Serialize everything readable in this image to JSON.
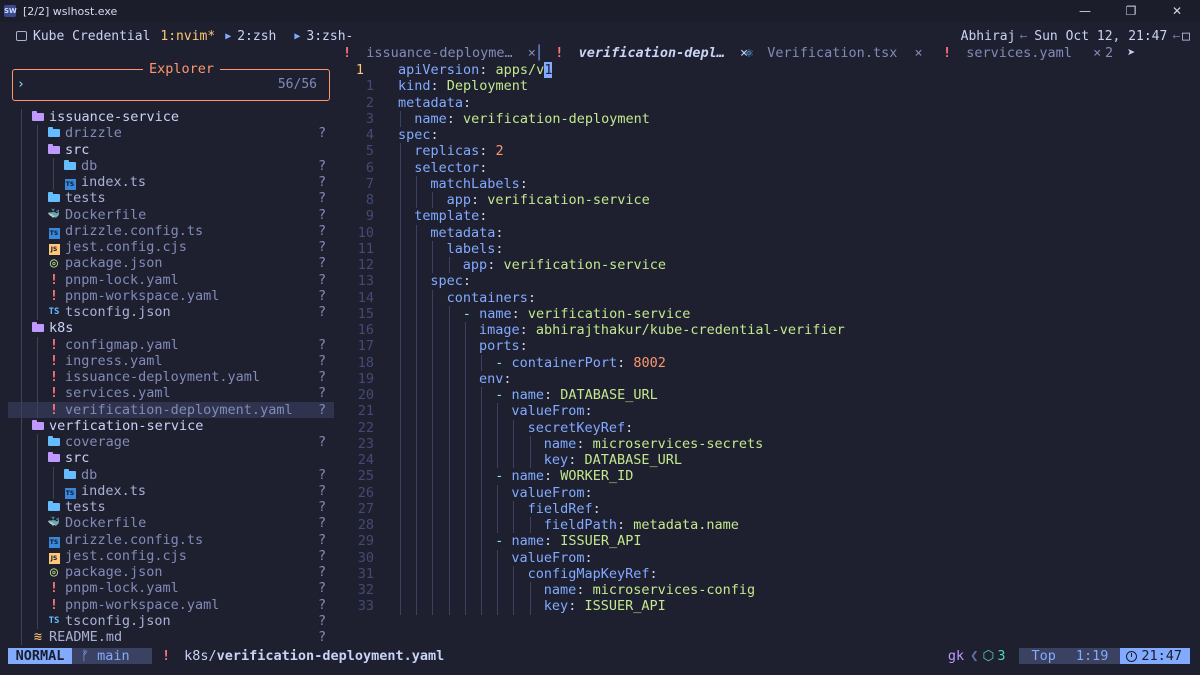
{
  "window": {
    "title": "[2/2] wslhost.exe",
    "icon": "SW",
    "controls": [
      "minimize-icon",
      "maximize-icon",
      "close-icon"
    ]
  },
  "tmux": {
    "session": "Kube Credential",
    "windows": [
      "1:nvim*",
      "2:zsh",
      "3:zsh-"
    ],
    "user": "Abhiraj",
    "datetime": "Sun Oct 12, 21:47"
  },
  "explorer": {
    "title": "Explorer",
    "prompt": "›",
    "count": "56/56",
    "tree": [
      {
        "name": "issuance-service",
        "kind": "dir-open",
        "depth": 0
      },
      {
        "name": "drizzle",
        "kind": "dir",
        "depth": 1,
        "status": "?"
      },
      {
        "name": "src",
        "kind": "dir-open",
        "depth": 1
      },
      {
        "name": "db",
        "kind": "dir",
        "depth": 2,
        "status": "?"
      },
      {
        "name": "index.ts",
        "kind": "ts",
        "depth": 2,
        "status": "?"
      },
      {
        "name": "tests",
        "kind": "dir",
        "depth": 1,
        "status": "?"
      },
      {
        "name": "Dockerfile",
        "kind": "docker",
        "depth": 1,
        "status": "?"
      },
      {
        "name": "drizzle.config.ts",
        "kind": "ts",
        "depth": 1,
        "status": "?"
      },
      {
        "name": "jest.config.cjs",
        "kind": "js",
        "depth": 1,
        "status": "?"
      },
      {
        "name": "package.json",
        "kind": "npm",
        "depth": 1,
        "status": "?"
      },
      {
        "name": "pnpm-lock.yaml",
        "kind": "yaml",
        "depth": 1,
        "status": "?"
      },
      {
        "name": "pnpm-workspace.yaml",
        "kind": "yaml",
        "depth": 1,
        "status": "?"
      },
      {
        "name": "tsconfig.json",
        "kind": "tsconfig",
        "depth": 1,
        "status": "?"
      },
      {
        "name": "k8s",
        "kind": "dir-open",
        "depth": 0
      },
      {
        "name": "configmap.yaml",
        "kind": "yaml",
        "depth": 1,
        "status": "?"
      },
      {
        "name": "ingress.yaml",
        "kind": "yaml",
        "depth": 1,
        "status": "?"
      },
      {
        "name": "issuance-deployment.yaml",
        "kind": "yaml",
        "depth": 1,
        "status": "?"
      },
      {
        "name": "services.yaml",
        "kind": "yaml",
        "depth": 1,
        "status": "?"
      },
      {
        "name": "verification-deployment.yaml",
        "kind": "yaml",
        "depth": 1,
        "status": "?",
        "selected": true
      },
      {
        "name": "verfication-service",
        "kind": "dir-open",
        "depth": 0
      },
      {
        "name": "coverage",
        "kind": "dir",
        "depth": 1,
        "status": "?"
      },
      {
        "name": "src",
        "kind": "dir-open",
        "depth": 1
      },
      {
        "name": "db",
        "kind": "dir",
        "depth": 2,
        "status": "?"
      },
      {
        "name": "index.ts",
        "kind": "ts",
        "depth": 2,
        "status": "?"
      },
      {
        "name": "tests",
        "kind": "dir",
        "depth": 1,
        "status": "?"
      },
      {
        "name": "Dockerfile",
        "kind": "docker",
        "depth": 1,
        "status": "?"
      },
      {
        "name": "drizzle.config.ts",
        "kind": "ts",
        "depth": 1,
        "status": "?"
      },
      {
        "name": "jest.config.cjs",
        "kind": "js",
        "depth": 1,
        "status": "?"
      },
      {
        "name": "package.json",
        "kind": "npm",
        "depth": 1,
        "status": "?"
      },
      {
        "name": "pnpm-lock.yaml",
        "kind": "yaml",
        "depth": 1,
        "status": "?"
      },
      {
        "name": "pnpm-workspace.yaml",
        "kind": "yaml",
        "depth": 1,
        "status": "?"
      },
      {
        "name": "tsconfig.json",
        "kind": "tsconfig",
        "depth": 1,
        "status": "?"
      },
      {
        "name": "README.md",
        "kind": "md",
        "depth": 0,
        "status": "?"
      }
    ]
  },
  "tabs": [
    {
      "icon": "!",
      "label": "issuance-deployme…",
      "close": "×"
    },
    {
      "icon": "!",
      "label": "verification-depl…",
      "close": "×",
      "active": true
    },
    {
      "icon": "⚛",
      "label": "Verification.tsx",
      "close": "×"
    },
    {
      "icon": "!",
      "label": "services.yaml",
      "close": "×"
    },
    {
      "label": "2",
      "overflow": true
    }
  ],
  "editor": {
    "current_line": 1,
    "lines": [
      {
        "n": "1",
        "i": 0,
        "t": [
          [
            "k",
            "apiVersion"
          ],
          [
            "",
            "​: "
          ],
          [
            "s",
            "apps/v"
          ],
          [
            "cur",
            "1"
          ]
        ]
      },
      {
        "n": "1",
        "i": 0,
        "t": [
          [
            "k",
            "kind"
          ],
          [
            "",
            ": "
          ],
          [
            "s",
            "Deployment"
          ]
        ]
      },
      {
        "n": "2",
        "i": 0,
        "t": [
          [
            "k",
            "metadata"
          ],
          [
            "",
            ":"
          ]
        ]
      },
      {
        "n": "3",
        "i": 1,
        "t": [
          [
            "k",
            "name"
          ],
          [
            "",
            ": "
          ],
          [
            "s",
            "verification-deployment"
          ]
        ]
      },
      {
        "n": "4",
        "i": 0,
        "t": [
          [
            "k",
            "spec"
          ],
          [
            "",
            ":"
          ]
        ]
      },
      {
        "n": "5",
        "i": 1,
        "t": [
          [
            "k",
            "replicas"
          ],
          [
            "",
            ": "
          ],
          [
            "n",
            "2"
          ]
        ]
      },
      {
        "n": "6",
        "i": 1,
        "t": [
          [
            "k",
            "selector"
          ],
          [
            "",
            ":"
          ]
        ]
      },
      {
        "n": "7",
        "i": 2,
        "t": [
          [
            "k",
            "matchLabels"
          ],
          [
            "",
            ":"
          ]
        ]
      },
      {
        "n": "8",
        "i": 3,
        "t": [
          [
            "k",
            "app"
          ],
          [
            "",
            ": "
          ],
          [
            "s",
            "verification-service"
          ]
        ]
      },
      {
        "n": "9",
        "i": 1,
        "t": [
          [
            "k",
            "template"
          ],
          [
            "",
            ":"
          ]
        ]
      },
      {
        "n": "10",
        "i": 2,
        "t": [
          [
            "k",
            "metadata"
          ],
          [
            "",
            ":"
          ]
        ]
      },
      {
        "n": "11",
        "i": 3,
        "t": [
          [
            "k",
            "labels"
          ],
          [
            "",
            ":"
          ]
        ]
      },
      {
        "n": "12",
        "i": 4,
        "t": [
          [
            "k",
            "app"
          ],
          [
            "",
            ": "
          ],
          [
            "s",
            "verification-service"
          ]
        ]
      },
      {
        "n": "13",
        "i": 2,
        "t": [
          [
            "k",
            "spec"
          ],
          [
            "",
            ":"
          ]
        ]
      },
      {
        "n": "14",
        "i": 3,
        "t": [
          [
            "k",
            "containers"
          ],
          [
            "",
            ":"
          ]
        ]
      },
      {
        "n": "15",
        "i": 4,
        "t": [
          [
            "p",
            "- "
          ],
          [
            "k",
            "name"
          ],
          [
            "",
            ": "
          ],
          [
            "s",
            "verification-service"
          ]
        ]
      },
      {
        "n": "16",
        "i": 5,
        "t": [
          [
            "k",
            "image"
          ],
          [
            "",
            ": "
          ],
          [
            "s",
            "abhirajthakur/kube-credential-verifier"
          ]
        ]
      },
      {
        "n": "17",
        "i": 5,
        "t": [
          [
            "k",
            "ports"
          ],
          [
            "",
            ":"
          ]
        ]
      },
      {
        "n": "18",
        "i": 6,
        "t": [
          [
            "p",
            "- "
          ],
          [
            "k",
            "containerPort"
          ],
          [
            "",
            ": "
          ],
          [
            "n",
            "8002"
          ]
        ]
      },
      {
        "n": "19",
        "i": 5,
        "t": [
          [
            "k",
            "env"
          ],
          [
            "",
            ":"
          ]
        ]
      },
      {
        "n": "20",
        "i": 6,
        "t": [
          [
            "p",
            "- "
          ],
          [
            "k",
            "name"
          ],
          [
            "",
            ": "
          ],
          [
            "s",
            "DATABASE_URL"
          ]
        ]
      },
      {
        "n": "21",
        "i": 7,
        "t": [
          [
            "k",
            "valueFrom"
          ],
          [
            "",
            ":"
          ]
        ]
      },
      {
        "n": "22",
        "i": 8,
        "t": [
          [
            "k",
            "secretKeyRef"
          ],
          [
            "",
            ":"
          ]
        ]
      },
      {
        "n": "23",
        "i": 9,
        "t": [
          [
            "k",
            "name"
          ],
          [
            "",
            ": "
          ],
          [
            "s",
            "microservices-secrets"
          ]
        ]
      },
      {
        "n": "24",
        "i": 9,
        "t": [
          [
            "k",
            "key"
          ],
          [
            "",
            ": "
          ],
          [
            "s",
            "DATABASE_URL"
          ]
        ]
      },
      {
        "n": "25",
        "i": 6,
        "t": [
          [
            "p",
            "- "
          ],
          [
            "k",
            "name"
          ],
          [
            "",
            ": "
          ],
          [
            "s",
            "WORKER_ID"
          ]
        ]
      },
      {
        "n": "26",
        "i": 7,
        "t": [
          [
            "k",
            "valueFrom"
          ],
          [
            "",
            ":"
          ]
        ]
      },
      {
        "n": "27",
        "i": 8,
        "t": [
          [
            "k",
            "fieldRef"
          ],
          [
            "",
            ":"
          ]
        ]
      },
      {
        "n": "28",
        "i": 9,
        "t": [
          [
            "k",
            "fieldPath"
          ],
          [
            "",
            ": "
          ],
          [
            "s",
            "metadata.name"
          ]
        ]
      },
      {
        "n": "29",
        "i": 6,
        "t": [
          [
            "p",
            "- "
          ],
          [
            "k",
            "name"
          ],
          [
            "",
            ": "
          ],
          [
            "s",
            "ISSUER_API"
          ]
        ]
      },
      {
        "n": "30",
        "i": 7,
        "t": [
          [
            "k",
            "valueFrom"
          ],
          [
            "",
            ":"
          ]
        ]
      },
      {
        "n": "31",
        "i": 8,
        "t": [
          [
            "k",
            "configMapKeyRef"
          ],
          [
            "",
            ":"
          ]
        ]
      },
      {
        "n": "32",
        "i": 9,
        "t": [
          [
            "k",
            "name"
          ],
          [
            "",
            ": "
          ],
          [
            "s",
            "microservices-config"
          ]
        ]
      },
      {
        "n": "33",
        "i": 9,
        "t": [
          [
            "k",
            "key"
          ],
          [
            "",
            ": "
          ],
          [
            "s",
            "ISSUER_API"
          ]
        ]
      }
    ]
  },
  "statusbar": {
    "mode": "NORMAL",
    "branch_icon": "ᚠ",
    "branch": "main",
    "file_icon": "!",
    "dir": "k8s/",
    "file": "verification-deployment.yaml",
    "gk": "gk",
    "lsp_count": "3",
    "scroll": "Top",
    "position": "1:19",
    "time": "21:47"
  },
  "colors": {
    "bg": "#1e2030",
    "accent": "#82aaff",
    "orange": "#ff966c",
    "yaml_icon": "#ff757f",
    "folder": "#82aaff",
    "folder_open": "#c099ff",
    "string": "#c3e88d"
  }
}
